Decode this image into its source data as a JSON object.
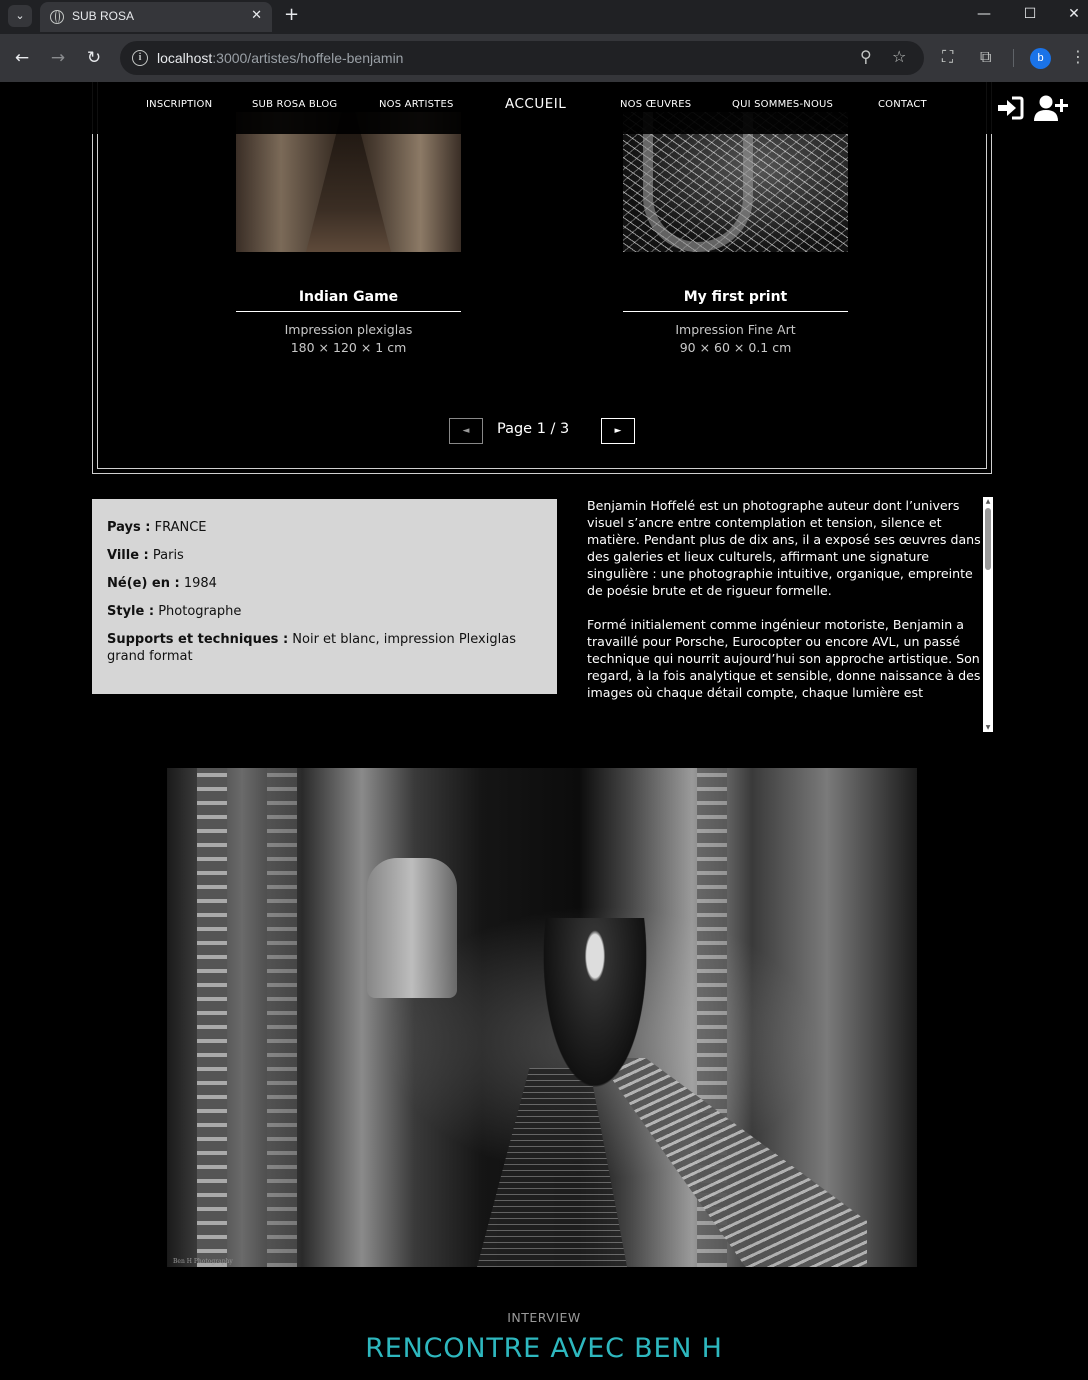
{
  "browser": {
    "tab_title": "SUB ROSA",
    "url_host": "localhost",
    "url_rest": ":3000/artistes/hoffele-benjamin",
    "profile_initial": "b"
  },
  "nav": {
    "items": [
      "INSCRIPTION",
      "SUB ROSA BLOG",
      "NOS ARTISTES",
      "ACCUEIL",
      "NOS ŒUVRES",
      "QUI SOMMES-NOUS",
      "CONTACT"
    ]
  },
  "gallery": {
    "artworks": [
      {
        "title": "Indian Game",
        "medium": "Impression plexiglas",
        "size": "180 × 120 × 1 cm"
      },
      {
        "title": "My first print",
        "medium": "Impression Fine Art",
        "size": "90 × 60 × 0.1 cm"
      }
    ],
    "pagination": {
      "label": "Page 1 / 3",
      "prev": "◄",
      "next": "►"
    }
  },
  "artist_info": {
    "country_label": "Pays :",
    "country": " FRANCE",
    "city_label": "Ville :",
    "city": " Paris",
    "born_label": "Né(e) en :",
    "born": " 1984",
    "style_label": "Style :",
    "style": " Photographe",
    "supports_label": "Supports et techniques :",
    "supports": " Noir et blanc, impression Plexiglas grand format"
  },
  "bio": {
    "p1": "Benjamin Hoffelé est un photographe auteur dont l’univers visuel s’ancre entre contemplation et tension, silence et matière. Pendant plus de dix ans, il a exposé ses œuvres dans des galeries et lieux culturels, affirmant une signature singulière : une photographie intuitive, organique, empreinte de poésie brute et de rigueur formelle.",
    "p2": "Formé initialement comme ingénieur motoriste, Benjamin a travaillé pour Porsche, Eurocopter ou encore AVL, un passé technique qui nourrit aujourd’hui son approche artistique. Son regard, à la fois analytique et sensible, donne naissance à des images où chaque détail compte, chaque lumière est"
  },
  "hero": {
    "signature": "Ben H Photography"
  },
  "interview": {
    "label": "INTERVIEW",
    "title": "RENCONTRE AVEC BEN H"
  }
}
